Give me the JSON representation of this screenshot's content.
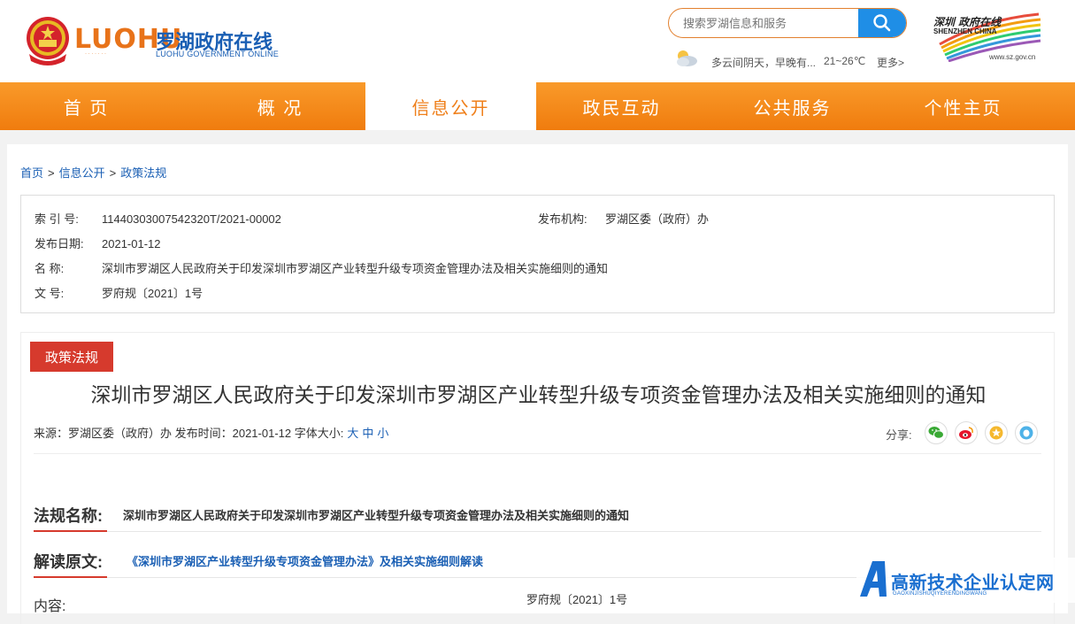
{
  "header": {
    "logo_en": "LUOHU",
    "logo_cn": "罗湖政府在线",
    "logo_sub": "LUOHU GOVERNMENT ONLINE",
    "logo_tiny": "·  ·  ·  ·    ·  ·  ·",
    "search_placeholder": "搜索罗湖信息和服务",
    "weather_text": "多云间阴天，早晚有...",
    "weather_temp": "21~26℃",
    "weather_more": "更多>",
    "sz_title": "深圳 政府在线",
    "sz_sub": "SHENZHEN CHINA",
    "sz_url": "www.sz.gov.cn"
  },
  "nav": [
    {
      "label": "首 页"
    },
    {
      "label": "概 况"
    },
    {
      "label": "信息公开"
    },
    {
      "label": "政民互动"
    },
    {
      "label": "公共服务"
    },
    {
      "label": "个性主页"
    }
  ],
  "breadcrumb": {
    "home": "首页",
    "level1": "信息公开",
    "level2": "政策法规",
    "sep": ">"
  },
  "meta": {
    "index_label": "索 引 号:",
    "index_value": "11440303007542320T/2021-00002",
    "org_label": "发布机构:",
    "org_value": "罗湖区委（政府）办",
    "date_label": "发布日期:",
    "date_value": "2021-01-12",
    "name_label": "名    称:",
    "name_value": "深圳市罗湖区人民政府关于印发深圳市罗湖区产业转型升级专项资金管理办法及相关实施细则的通知",
    "doc_label": "文    号:",
    "doc_value": "罗府规〔2021〕1号"
  },
  "article": {
    "tag": "政策法规",
    "title": "深圳市罗湖区人民政府关于印发深圳市罗湖区产业转型升级专项资金管理办法及相关实施细则的通知",
    "source": "来源：罗湖区委（政府）办  发布时间：2021-01-12 字体大小:",
    "font_large": "大",
    "font_medium": "中",
    "font_small": "小",
    "share_label": "分享:",
    "law_name_label": "法规名称:",
    "law_name_value": "深圳市罗湖区人民政府关于印发深圳市罗湖区产业转型升级专项资金管理办法及相关实施细则的通知",
    "interp_label": "解读原文:",
    "interp_value": "《深圳市罗湖区产业转型升级专项资金管理办法》及相关实施细则解读",
    "content_label": "内容:",
    "content_value": "罗府规〔2021〕1号"
  },
  "watermark": {
    "text": "高新技术企业认定网",
    "sub": "GAOXINJISHUQIYERENDINGWANG"
  },
  "colors": {
    "orange": "#f07c0e",
    "red": "#d63a2d",
    "blue": "#1a5fb4"
  }
}
